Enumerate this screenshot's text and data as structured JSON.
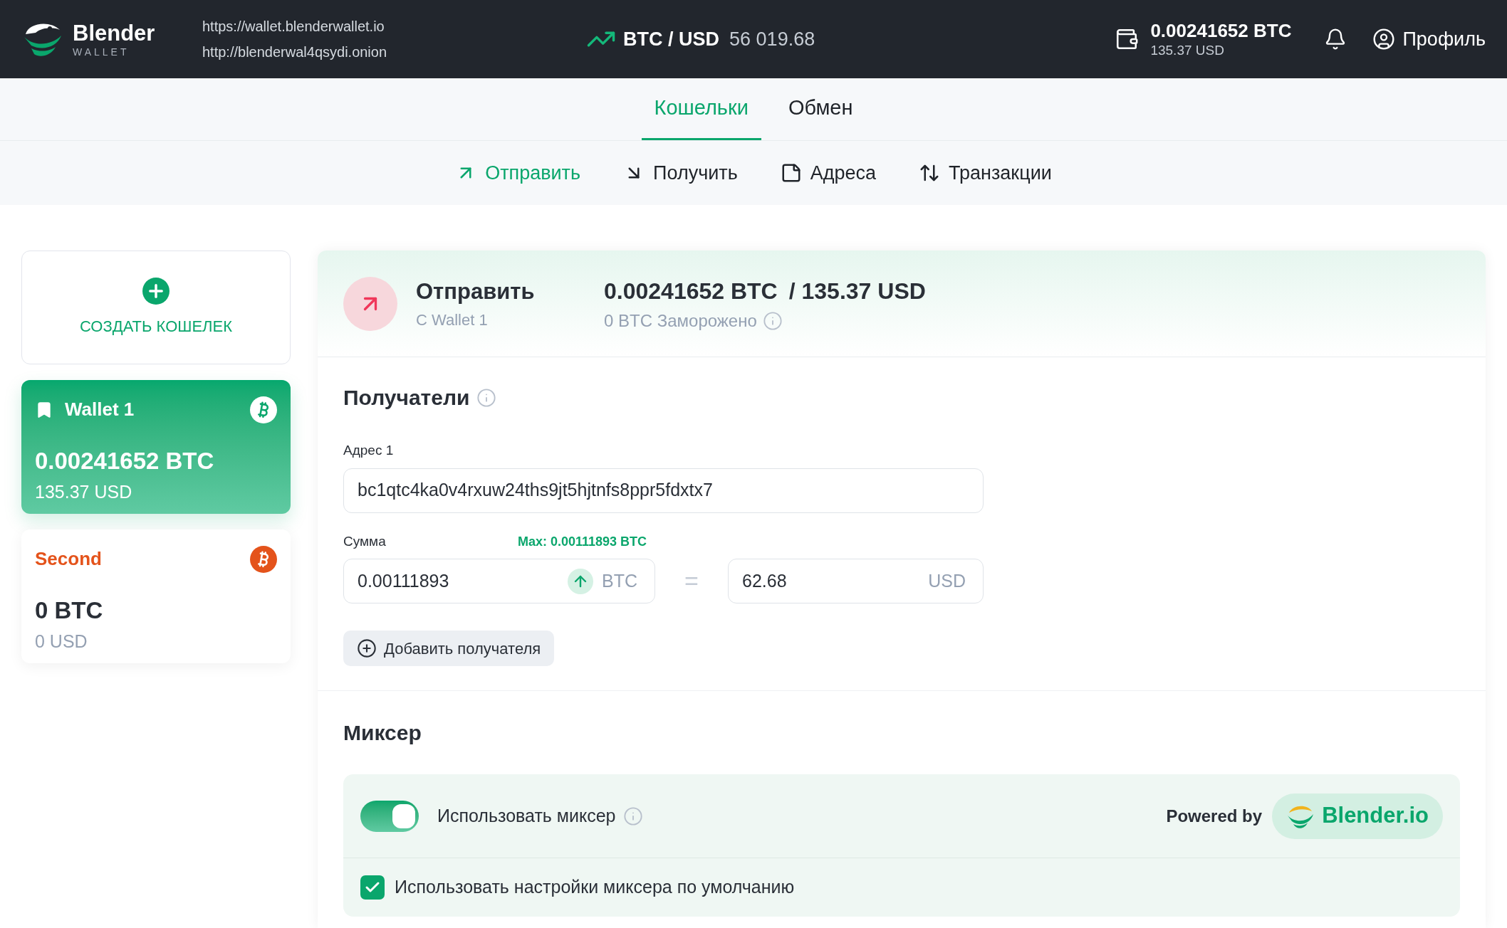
{
  "header": {
    "logo": {
      "name": "Blender",
      "sub": "WALLET"
    },
    "urls": [
      "https://wallet.blenderwallet.io",
      "http://blenderwal4qsydi.onion"
    ],
    "ticker": {
      "pair": "BTC / USD",
      "price": "56 019.68"
    },
    "balance": {
      "btc": "0.00241652 BTC",
      "usd": "135.37 USD"
    },
    "profile": "Профиль"
  },
  "tabs": [
    {
      "label": "Кошельки",
      "selected": true
    },
    {
      "label": "Обмен",
      "selected": false
    }
  ],
  "subnav": [
    {
      "label": "Отправить",
      "selected": true
    },
    {
      "label": "Получить",
      "selected": false
    },
    {
      "label": "Адреса",
      "selected": false
    },
    {
      "label": "Транзакции",
      "selected": false
    }
  ],
  "sidebar": {
    "create_label": "СОЗДАТЬ КОШЕЛЕК",
    "wallets": [
      {
        "name": "Wallet 1",
        "btc": "0.00241652 BTC",
        "usd": "135.37 USD",
        "selected": true,
        "color": "#0aa66c"
      },
      {
        "name": "Second",
        "btc": "0 BTC",
        "usd": "0 USD",
        "selected": false,
        "color": "#e4531b"
      }
    ]
  },
  "send": {
    "title": "Отправить",
    "subtitle": "С Wallet 1",
    "balance_btc": "0.00241652 BTC",
    "balance_usd": "/ 135.37 USD",
    "frozen": "0 BTC Заморожено"
  },
  "recipients": {
    "title": "Получатели",
    "address_label": "Адрес 1",
    "address_value": "bc1qtc4ka0v4rxuw24ths9jt5hjtnfs8ppr5fdxtx7",
    "amount_label": "Сумма",
    "max": "Max: 0.00111893 BTC",
    "amount_value": "0.00111893",
    "amount_unit": "BTC",
    "equals": "=",
    "usd_value": "62.68",
    "usd_unit": "USD",
    "add_button": "Добавить получателя"
  },
  "mixer": {
    "title": "Миксер",
    "toggle": {
      "label": "Использовать миксер",
      "on": true
    },
    "powered_by": "Powered by",
    "brand": "Blender.io",
    "default_checkbox": {
      "label": "Использовать настройки миксера по умолчанию",
      "checked": true
    }
  }
}
